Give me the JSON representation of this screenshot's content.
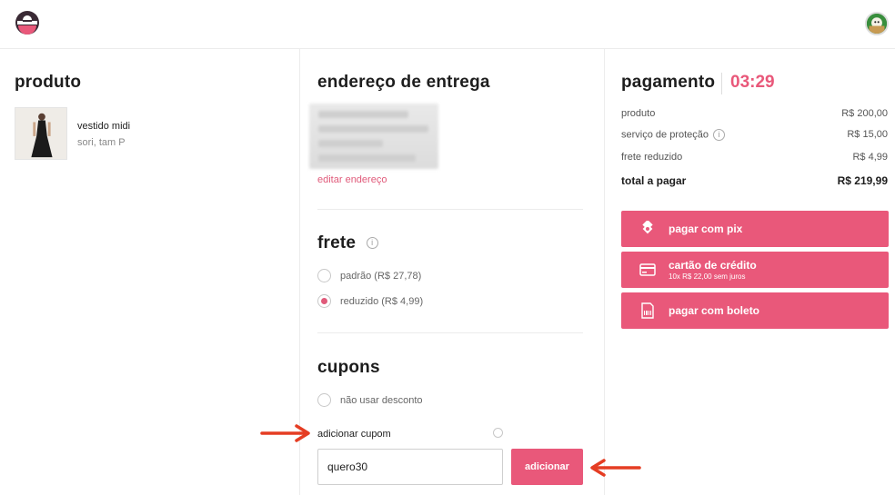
{
  "header": {
    "logo_icon": "enjoei-logo-icon",
    "avatar_icon": "user-avatar-icon"
  },
  "product": {
    "title": "produto",
    "name": "vestido midi",
    "details": "sori, tam P"
  },
  "shipping_address": {
    "title": "endereço de entrega",
    "edit_link": "editar endereço"
  },
  "freight": {
    "title": "frete",
    "options": [
      {
        "label": "padrão (R$ 27,78)",
        "selected": false
      },
      {
        "label": "reduzido (R$ 4,99)",
        "selected": true
      }
    ]
  },
  "coupons": {
    "title": "cupons",
    "no_discount_label": "não usar desconto",
    "add_coupon_label": "adicionar cupom",
    "coupon_value": "quero30",
    "add_button": "adicionar"
  },
  "payment": {
    "title": "pagamento",
    "timer": "03:29",
    "summary": [
      {
        "label": "produto",
        "value": "R$ 200,00"
      },
      {
        "label": "serviço de proteção",
        "value": "R$ 15,00"
      },
      {
        "label": "frete reduzido",
        "value": "R$ 4,99"
      }
    ],
    "total_label": "total a pagar",
    "total_value": "R$ 219,99",
    "buttons": [
      {
        "label": "pagar com pix",
        "icon": "pix-icon"
      },
      {
        "label": "cartão de crédito",
        "sub": "10x R$ 22,00 sem juros",
        "icon": "credit-card-icon"
      },
      {
        "label": "pagar com boleto",
        "icon": "boleto-icon"
      }
    ]
  },
  "colors": {
    "accent": "#e9587a",
    "link": "#e05a7a",
    "annotation_arrow": "#e53d23"
  }
}
